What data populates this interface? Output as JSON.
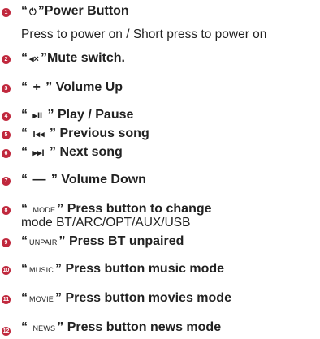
{
  "colors": {
    "badge": "#c0283d",
    "text": "#222222"
  },
  "items": [
    {
      "num": "1",
      "open": "“",
      "symbol": "⏻",
      "close": "”",
      "label": "Power Button",
      "sub": "Press to power on / Short press to power on"
    },
    {
      "num": "2",
      "open": "“",
      "symbol": "◂×",
      "close": "”",
      "label": "Mute switch.",
      "sub": ""
    },
    {
      "num": "3",
      "open": "“",
      "symbol": "+",
      "close": "”",
      "label": "Volume Up",
      "sub": ""
    },
    {
      "num": "4",
      "open": "“",
      "symbol": "▸II",
      "close": "”",
      "label": "Play / Pause",
      "sub": ""
    },
    {
      "num": "5",
      "open": "“",
      "symbol": "I◂◂",
      "close": "”",
      "label": "Previous song",
      "sub": ""
    },
    {
      "num": "6",
      "open": "“",
      "symbol": "▸▸I",
      "close": "”",
      "label": "Next song",
      "sub": ""
    },
    {
      "num": "7",
      "open": "“",
      "symbol": "—",
      "close": "”",
      "label": "Volume Down",
      "sub": ""
    },
    {
      "num": "8",
      "open": "“",
      "symbol": "MODE",
      "close": "”",
      "label": "Press button to change",
      "sub": "mode BT/ARC/OPT/AUX/USB"
    },
    {
      "num": "9",
      "open": "“",
      "symbol": "UNPAIR",
      "close": "”",
      "label": "Press BT unpaired",
      "sub": ""
    },
    {
      "num": "10",
      "open": "“",
      "symbol": "MUSIC",
      "close": "”",
      "label": "Press button music mode",
      "sub": ""
    },
    {
      "num": "11",
      "open": "“",
      "symbol": "MOVIE",
      "close": "”",
      "label": "Press button movies mode",
      "sub": ""
    },
    {
      "num": "12",
      "open": "“",
      "symbol": "NEWS",
      "close": "”",
      "label": "Press button news mode",
      "sub": ""
    }
  ]
}
